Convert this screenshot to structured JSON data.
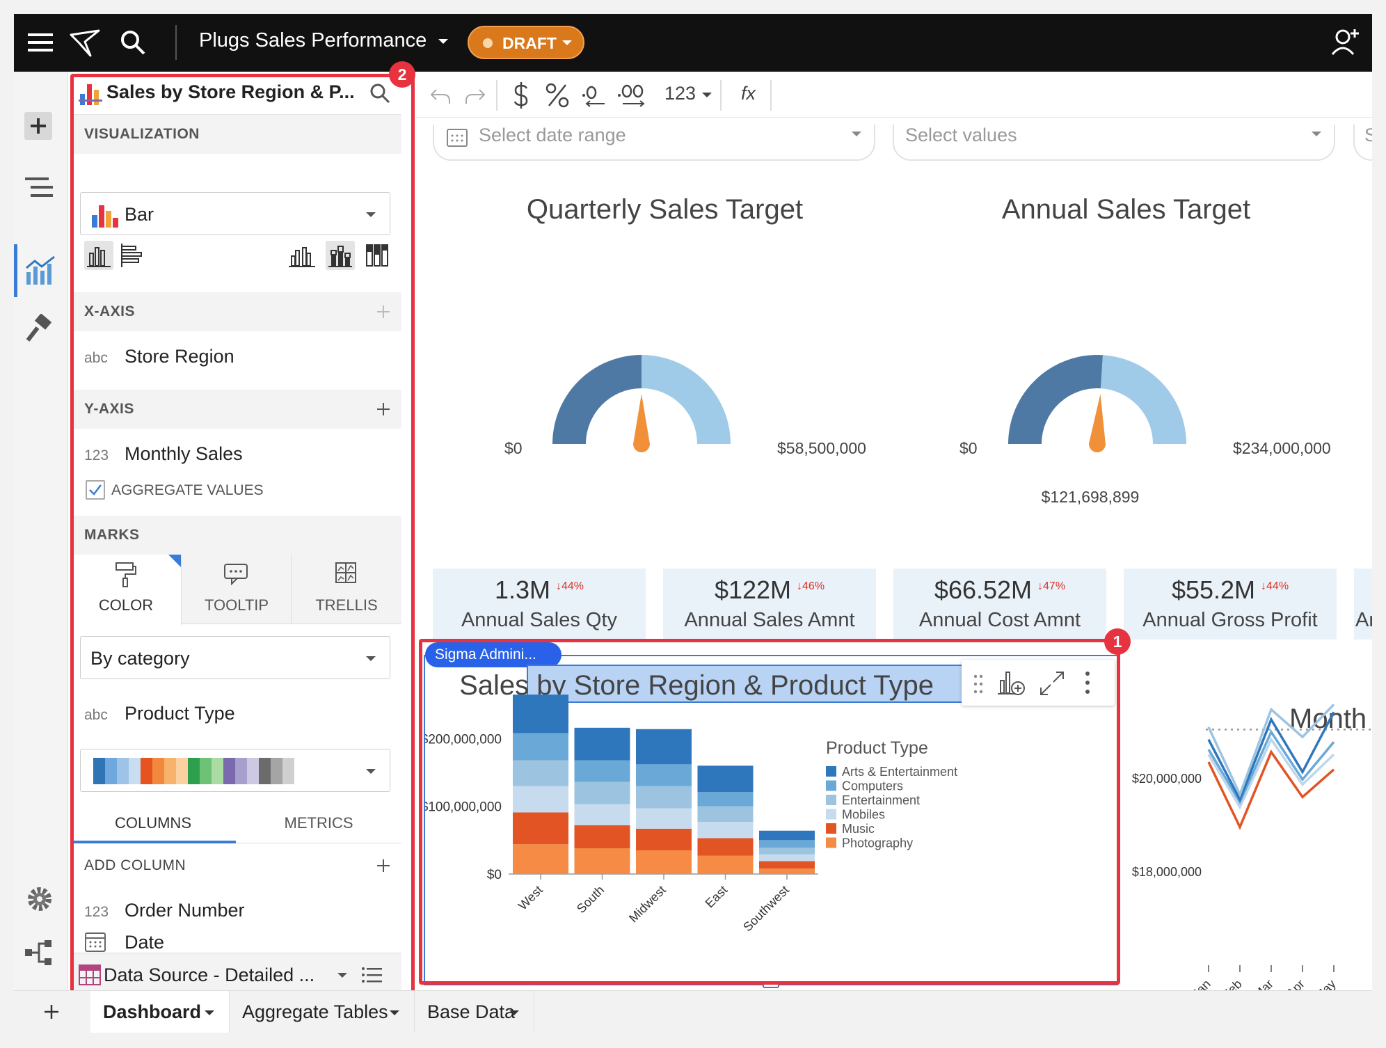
{
  "colors": {
    "topbar": "#111111",
    "draft": "#d9791b",
    "highlight": "#e7323f",
    "gauge_dark": "#4e79a5",
    "gauge_light": "#a0cbe8",
    "needle": "#f0913a",
    "delta_red": "#d9342b"
  },
  "topbar": {
    "title": "Plugs Sales Performance",
    "status": "DRAFT",
    "icons": [
      "menu-icon",
      "sigma-logo",
      "search-icon",
      "add-user-icon"
    ]
  },
  "toolbar": {
    "format_number": "123",
    "fx": "fx"
  },
  "panel": {
    "title": "Sales by Store Region & P...",
    "visualization_header": "VISUALIZATION",
    "chart_type": "Bar",
    "xaxis_header": "X-AXIS",
    "xaxis_field": {
      "type": "abc",
      "name": "Store Region"
    },
    "yaxis_header": "Y-AXIS",
    "yaxis_field": {
      "type": "123",
      "name": "Monthly Sales"
    },
    "aggregate_label": "AGGREGATE VALUES",
    "marks_header": "MARKS",
    "marks_tabs": [
      "COLOR",
      "TOOLTIP",
      "TRELLIS"
    ],
    "color_mode": "By category",
    "color_field": {
      "type": "abc",
      "name": "Product Type"
    },
    "palette": [
      "#2f75b5",
      "#6fa8dc",
      "#9dc3e6",
      "#c9ddf0",
      "#e6531f",
      "#f2883d",
      "#f7b26b",
      "#fbd1a2",
      "#2e9e4f",
      "#6fc275",
      "#a9dba3",
      "#7a69ad",
      "#a79fcc",
      "#cdc9e3",
      "#6b6b6b",
      "#a5a5a5",
      "#d0d0d0"
    ],
    "bottom_tabs": [
      "COLUMNS",
      "METRICS"
    ],
    "add_column_label": "ADD COLUMN",
    "columns": [
      {
        "type": "123",
        "name": "Order Number"
      },
      {
        "type": "date",
        "name": "Date"
      }
    ],
    "data_source": "Data Source - Detailed ..."
  },
  "canvas": {
    "date_filter_placeholder": "Select date range",
    "values_filter_placeholder": "Select values",
    "third_filter_fragment": "Se",
    "quarterly": {
      "title": "Quarterly Sales Target",
      "min": "$0",
      "max": "$58,500,000",
      "value": "",
      "fraction": 0.5
    },
    "annual": {
      "title": "Annual Sales Target",
      "min": "$0",
      "max": "$234,000,000",
      "value": "$121,698,899",
      "fraction": 0.52
    },
    "kpis": [
      {
        "value": "1.3M",
        "delta": "↓44%",
        "label": "Annual Sales Qty"
      },
      {
        "value": "$122M",
        "delta": "↓46%",
        "label": "Annual Sales Amnt"
      },
      {
        "value": "$66.52M",
        "delta": "↓47%",
        "label": "Annual Cost Amnt"
      },
      {
        "value": "$55.2M",
        "delta": "↓44%",
        "label": "Annual Gross Profit"
      },
      {
        "value": "",
        "delta": "",
        "label": "Ann"
      }
    ],
    "selection_tag": "Sigma Admini...",
    "right_chart_title_fragment": "Month"
  },
  "chart_data": [
    {
      "type": "bar",
      "title": "Sales by Store Region & Product Type",
      "xlabel": "",
      "ylabel": "",
      "legend_title": "Product Type",
      "legend_position": "right",
      "ylim": [
        0,
        260000000
      ],
      "yticks": [
        "$0",
        "$100,000,000",
        "$200,000,000"
      ],
      "categories": [
        "West",
        "South",
        "Midwest",
        "East",
        "Southwest"
      ],
      "series": [
        {
          "name": "Photography",
          "color": "#f58b45",
          "values": [
            44000000,
            38000000,
            35000000,
            27000000,
            8000000
          ]
        },
        {
          "name": "Music",
          "color": "#e25424",
          "values": [
            47000000,
            34000000,
            32000000,
            26000000,
            11000000
          ]
        },
        {
          "name": "Mobiles",
          "color": "#c7dbee",
          "values": [
            39000000,
            31000000,
            30000000,
            24000000,
            10000000
          ]
        },
        {
          "name": "Entertainment",
          "color": "#9cc4e1",
          "values": [
            38000000,
            33000000,
            33000000,
            23000000,
            10000000
          ]
        },
        {
          "name": "Computers",
          "color": "#6aa9d7",
          "values": [
            40000000,
            32000000,
            32000000,
            21000000,
            11000000
          ]
        },
        {
          "name": "Arts & Entertainment",
          "color": "#2f77bd",
          "values": [
            57000000,
            48000000,
            52000000,
            39000000,
            14000000
          ]
        }
      ]
    },
    {
      "type": "line",
      "title": "Month",
      "categories": [
        "Jan",
        "Feb",
        "Mar",
        "Apr",
        "May"
      ],
      "yticks": [
        "$18,000,000",
        "$20,000,000"
      ],
      "ylim": [
        17000000,
        20200000
      ],
      "reference_value": 19500000,
      "series": [
        {
          "color": "#e25424",
          "values": [
            18850000,
            17550000,
            19050000,
            18150000,
            18700000
          ]
        },
        {
          "color": "#bcd6ec",
          "values": [
            19000000,
            17950000,
            19300000,
            18400000,
            19000000
          ]
        },
        {
          "color": "#6aa9d7",
          "values": [
            19100000,
            18050000,
            19450000,
            18500000,
            19250000
          ]
        },
        {
          "color": "#2f77bd",
          "values": [
            19300000,
            18100000,
            19700000,
            18650000,
            19850000
          ]
        },
        {
          "color": "#9cc4e1",
          "values": [
            19550000,
            18200000,
            19900000,
            19350000,
            20000000
          ]
        }
      ]
    }
  ],
  "sheet_tabs": [
    "Dashboard",
    "Aggregate Tables",
    "Base Data"
  ]
}
